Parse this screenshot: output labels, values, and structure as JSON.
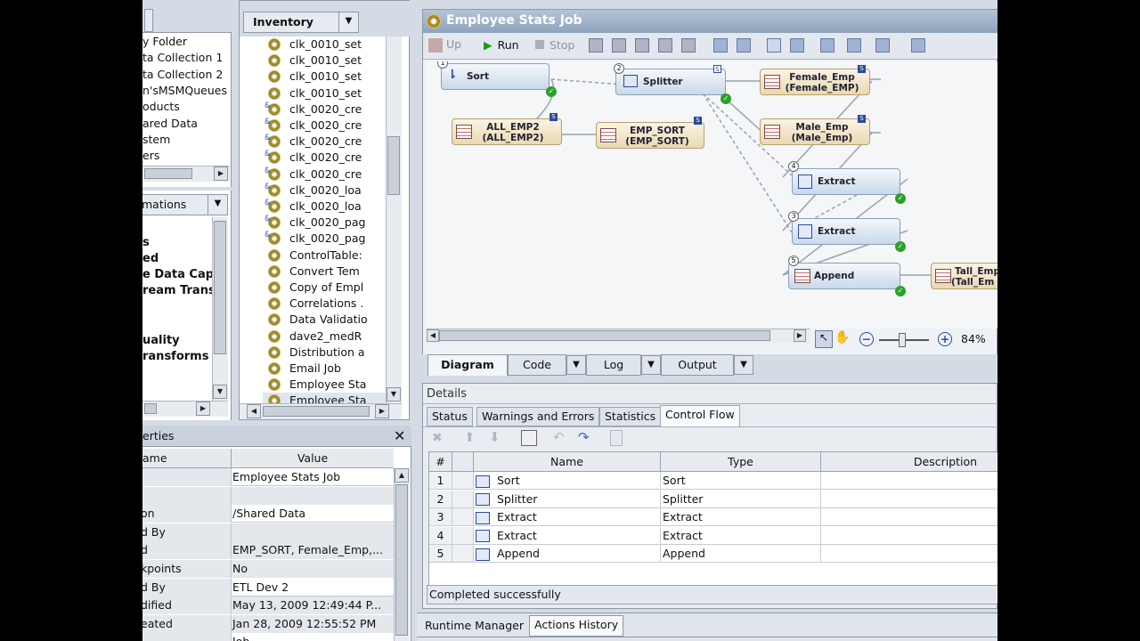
{
  "folders_tree": {
    "items": [
      "y Folder",
      "ta Collection 1",
      "ta Collection 2",
      "n'sMSMQueues",
      "oducts",
      "ared Data",
      "stem",
      "ers"
    ]
  },
  "transformations": {
    "tab_label": "mations",
    "items": [
      "s",
      "ed",
      "e Data Cap",
      "ream Trans",
      "",
      "uality",
      "ransforms"
    ]
  },
  "inventory": {
    "tab_label": "Inventory",
    "items": [
      "clk_0010_set",
      "clk_0010_set",
      "clk_0010_set",
      "clk_0010_set",
      "clk_0020_cre",
      "clk_0020_cre",
      "clk_0020_cre",
      "clk_0020_cre",
      "clk_0020_cre",
      "clk_0020_loa",
      "clk_0020_loa",
      "clk_0020_pag",
      "clk_0020_pag",
      "ControlTable:",
      "Convert Tem",
      "Copy of Empl",
      "Correlations .",
      "Data Validatio",
      "dave2_medR",
      "Distribution a",
      "Email Job",
      "Employee Sta",
      "Employee Sta"
    ]
  },
  "properties": {
    "title": "erties",
    "col_name": "ame",
    "col_value": "Value",
    "rows": [
      {
        "name": "",
        "value": "Employee Stats Job"
      },
      {
        "name": "",
        "value": ""
      },
      {
        "name": "on",
        "value": "/Shared Data"
      },
      {
        "name": "d By",
        "value": ""
      },
      {
        "name": "d",
        "value": "EMP_SORT, Female_Emp,..."
      },
      {
        "name": "kpoints",
        "value": "No"
      },
      {
        "name": "d By",
        "value": "ETL Dev 2"
      },
      {
        "name": "dified",
        "value": "May 13, 2009 12:49:44 P..."
      },
      {
        "name": "eated",
        "value": "Jan 28, 2009 12:55:52 PM"
      },
      {
        "name": "",
        "value": "Job"
      }
    ]
  },
  "job": {
    "title": "Employee Stats Job",
    "toolbar": {
      "up": "Up",
      "run": "Run",
      "stop": "Stop"
    },
    "zoom": "84%",
    "nodes": {
      "sort": "Sort",
      "all_emp2": [
        "ALL_EMP2",
        "(ALL_EMP2)"
      ],
      "splitter": "Splitter",
      "emp_sort": [
        "EMP_SORT",
        "(EMP_SORT)"
      ],
      "female": [
        "Female_Emp",
        "(Female_EMP)"
      ],
      "male": [
        "Male_Emp",
        "(Male_Emp)"
      ],
      "extract1": "Extract",
      "extract2": "Extract",
      "append": "Append",
      "tall": [
        "Tall_Emp",
        "(Tall_Em"
      ]
    },
    "step_numbers": [
      "1",
      "2",
      "4",
      "3",
      "5"
    ],
    "tabs": [
      "Diagram",
      "Code",
      "Log",
      "Output"
    ]
  },
  "details": {
    "title": "Details",
    "tabs": [
      "Status",
      "Warnings and Errors",
      "Statistics",
      "Control Flow"
    ],
    "columns": [
      "#",
      "Name",
      "Type",
      "Description"
    ],
    "rows": [
      {
        "n": "1",
        "name": "Sort",
        "type": "Sort",
        "desc": ""
      },
      {
        "n": "2",
        "name": "Splitter",
        "type": "Splitter",
        "desc": ""
      },
      {
        "n": "3",
        "name": "Extract",
        "type": "Extract",
        "desc": ""
      },
      {
        "n": "4",
        "name": "Extract",
        "type": "Extract",
        "desc": ""
      },
      {
        "n": "5",
        "name": "Append",
        "type": "Append",
        "desc": ""
      }
    ],
    "status_text": "Completed successfully"
  },
  "bottom_tabs": [
    "Runtime Manager",
    "Actions History"
  ]
}
